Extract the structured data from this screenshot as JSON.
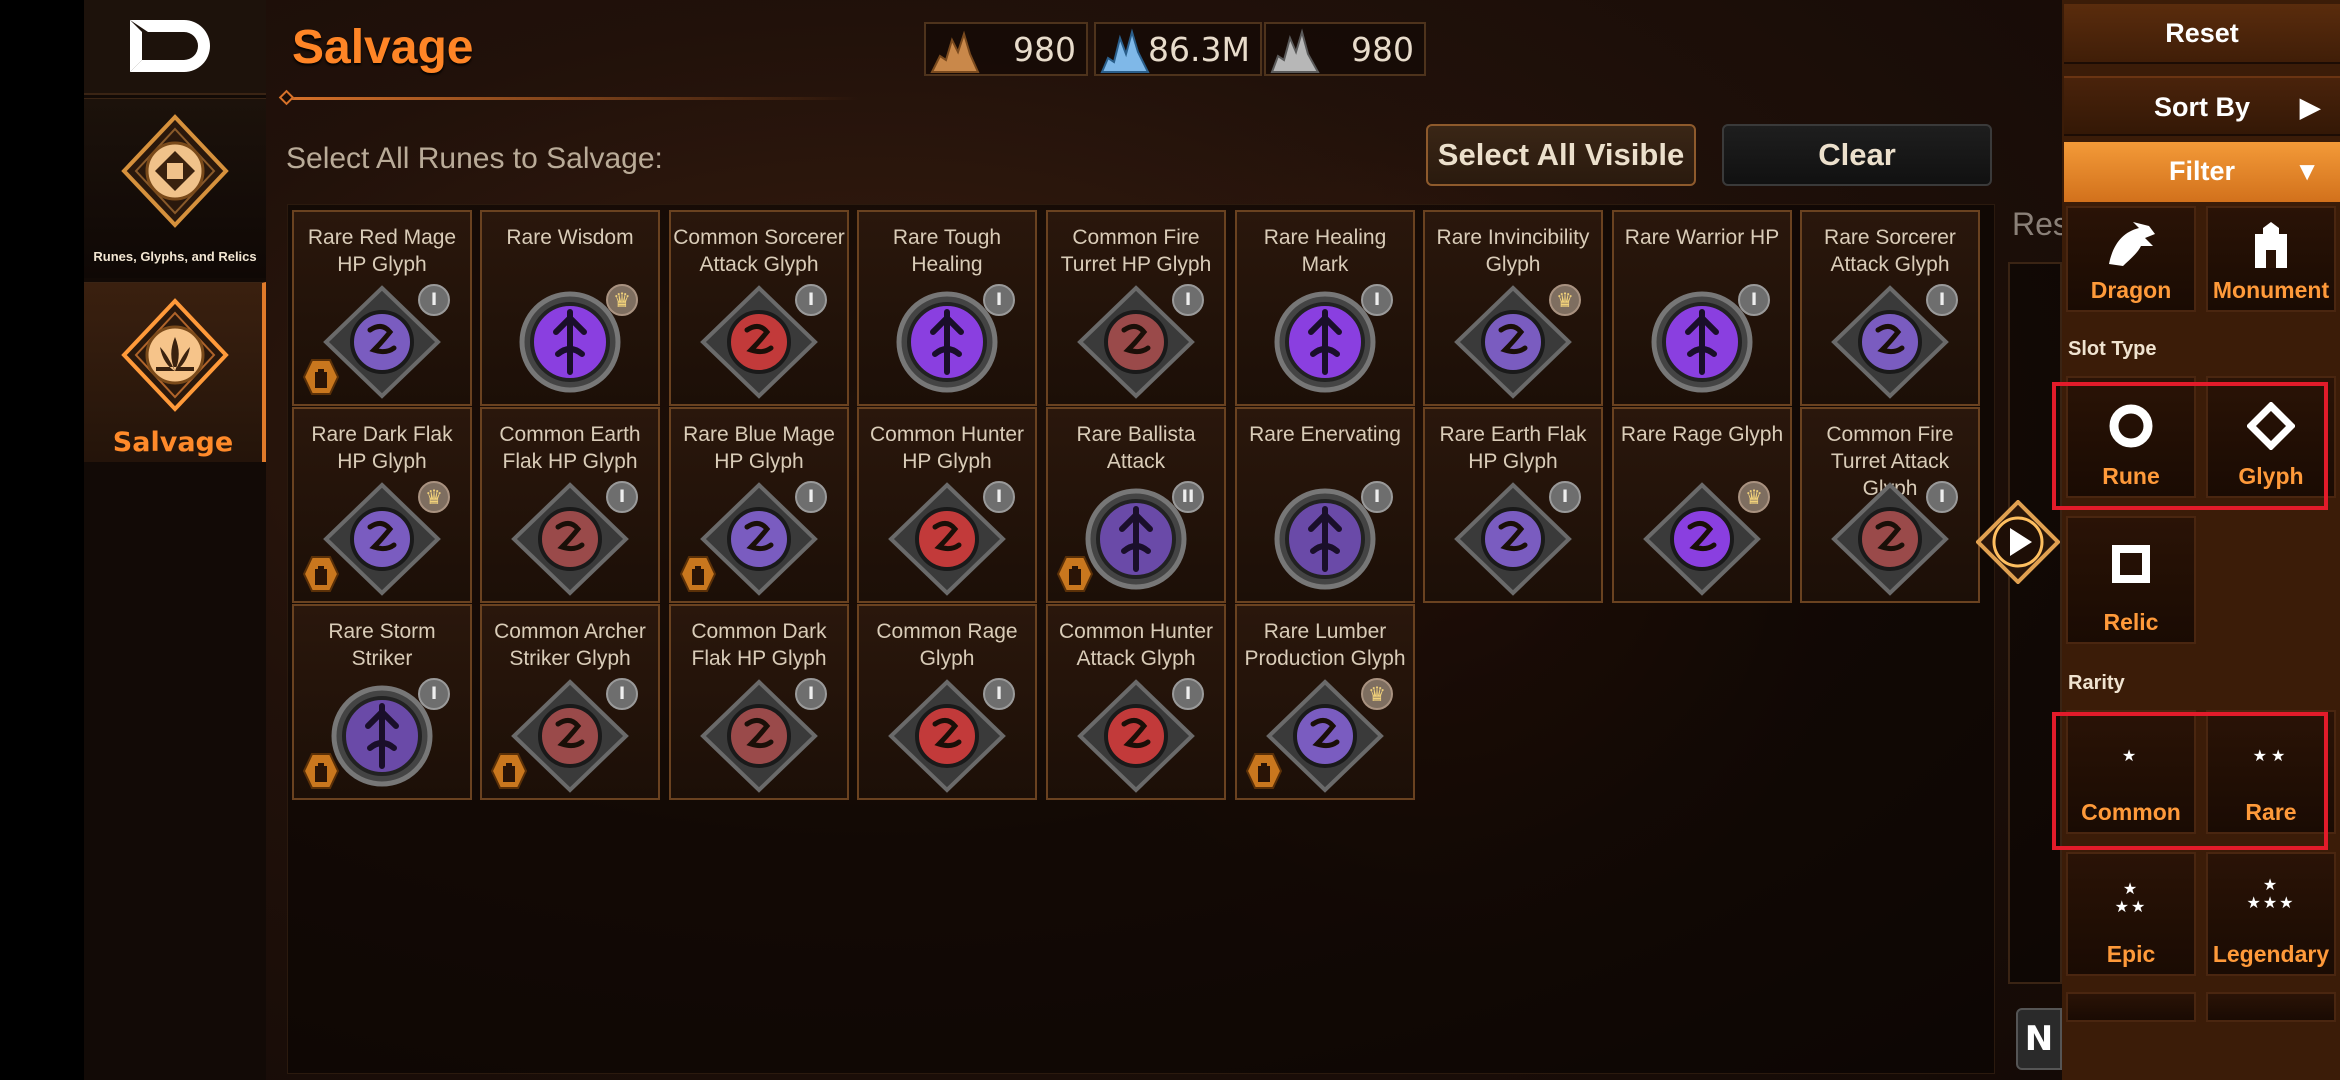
{
  "nav": {
    "back_icon": "back-arrow-icon",
    "tabs": [
      {
        "label": "Runes, Glyphs, and Relics",
        "icon": "rune-diamond-icon"
      },
      {
        "label": "Salvage",
        "icon": "salvage-lotus-icon"
      }
    ]
  },
  "header": {
    "title": "Salvage",
    "currencies": [
      {
        "icon": "dust-pile-icon",
        "value": "980",
        "color": "#c9884a"
      },
      {
        "icon": "crystal-pile-icon",
        "value": "86.3M",
        "color": "#7fb8e8"
      },
      {
        "icon": "silver-pile-icon",
        "value": "980",
        "color": "#b7b7b7"
      }
    ]
  },
  "toolbar": {
    "subtitle": "Select All Runes to Salvage:",
    "select_all_label": "Select All Visible",
    "clear_label": "Clear"
  },
  "items": [
    {
      "name": "Rare Red Mage\nHP Glyph",
      "shape": "glyph",
      "color": "#7a5cc0",
      "badge": "I",
      "crown": false,
      "lock": true
    },
    {
      "name": "Rare Wisdom",
      "shape": "rune",
      "color": "#8a3fe0",
      "badge": "♛",
      "crown": true,
      "lock": false
    },
    {
      "name": "Common Sorcerer\nAttack Glyph",
      "shape": "glyph",
      "color": "#c23a3a",
      "badge": "I",
      "crown": false,
      "lock": false
    },
    {
      "name": "Rare Tough\nHealing",
      "shape": "rune",
      "color": "#8a3fe0",
      "badge": "I",
      "crown": false,
      "lock": false
    },
    {
      "name": "Common Fire\nTurret HP Glyph",
      "shape": "glyph",
      "color": "#9a4a4a",
      "badge": "I",
      "crown": false,
      "lock": false
    },
    {
      "name": "Rare Healing\nMark",
      "shape": "rune",
      "color": "#8a3fe0",
      "badge": "I",
      "crown": false,
      "lock": false
    },
    {
      "name": "Rare Invincibility\nGlyph",
      "shape": "glyph",
      "color": "#7a5cc0",
      "badge": "♛",
      "crown": true,
      "lock": false
    },
    {
      "name": "Rare Warrior HP",
      "shape": "rune",
      "color": "#8a3fe0",
      "badge": "I",
      "crown": false,
      "lock": false
    },
    {
      "name": "Rare Sorcerer\nAttack Glyph",
      "shape": "glyph",
      "color": "#7a5cc0",
      "badge": "I",
      "crown": false,
      "lock": false
    },
    {
      "name": "Rare Dark Flak\nHP Glyph",
      "shape": "glyph",
      "color": "#7a5cc0",
      "badge": "♛",
      "crown": true,
      "lock": true
    },
    {
      "name": "Common Earth\nFlak HP Glyph",
      "shape": "glyph",
      "color": "#9a4a4a",
      "badge": "I",
      "crown": false,
      "lock": false
    },
    {
      "name": "Rare Blue Mage\nHP Glyph",
      "shape": "glyph",
      "color": "#7a5cc0",
      "badge": "I",
      "crown": false,
      "lock": true
    },
    {
      "name": "Common Hunter\nHP Glyph",
      "shape": "glyph",
      "color": "#c23a3a",
      "badge": "I",
      "crown": false,
      "lock": false
    },
    {
      "name": "Rare Ballista\nAttack",
      "shape": "rune",
      "color": "#6a4aa8",
      "badge": "II",
      "crown": false,
      "lock": true
    },
    {
      "name": "Rare Enervating",
      "shape": "rune",
      "color": "#6a4aa8",
      "badge": "I",
      "crown": false,
      "lock": false
    },
    {
      "name": "Rare Earth Flak\nHP Glyph",
      "shape": "glyph",
      "color": "#7a5cc0",
      "badge": "I",
      "crown": false,
      "lock": false
    },
    {
      "name": "Rare Rage Glyph",
      "shape": "glyph",
      "color": "#8a3fe0",
      "badge": "♛",
      "crown": true,
      "lock": false
    },
    {
      "name": "Common Fire\nTurret Attack Glyph",
      "shape": "glyph",
      "color": "#9a4a4a",
      "badge": "I",
      "crown": false,
      "lock": false
    },
    {
      "name": "Rare Storm\nStriker",
      "shape": "rune",
      "color": "#6a4aa8",
      "badge": "I",
      "crown": false,
      "lock": true
    },
    {
      "name": "Common Archer\nStriker Glyph",
      "shape": "glyph",
      "color": "#9a4a4a",
      "badge": "I",
      "crown": false,
      "lock": true
    },
    {
      "name": "Common Dark\nFlak HP Glyph",
      "shape": "glyph",
      "color": "#9a4a4a",
      "badge": "I",
      "crown": false,
      "lock": false
    },
    {
      "name": "Common Rage\nGlyph",
      "shape": "glyph",
      "color": "#c23a3a",
      "badge": "I",
      "crown": false,
      "lock": false
    },
    {
      "name": "Common Hunter\nAttack Glyph",
      "shape": "glyph",
      "color": "#c23a3a",
      "badge": "I",
      "crown": false,
      "lock": false
    },
    {
      "name": "Rare Lumber\nProduction Glyph",
      "shape": "glyph",
      "color": "#7a5cc0",
      "badge": "♛",
      "crown": true,
      "lock": true
    }
  ],
  "side": {
    "res_label": "Res",
    "next_icon": "play-arrow-icon",
    "n_label": "N"
  },
  "filter_panel": {
    "reset_label": "Reset",
    "sort_label": "Sort By",
    "filter_label": "Filter",
    "type_tiles": [
      {
        "label": "Dragon",
        "icon": "dragon-head-icon"
      },
      {
        "label": "Monument",
        "icon": "monument-icon"
      }
    ],
    "slot_type_label": "Slot Type",
    "slot_tiles": [
      {
        "label": "Rune",
        "icon": "circle-icon"
      },
      {
        "label": "Glyph",
        "icon": "diamond-icon"
      },
      {
        "label": "Relic",
        "icon": "square-icon"
      }
    ],
    "rarity_label": "Rarity",
    "rarity_tiles": [
      {
        "label": "Common",
        "stars": "★"
      },
      {
        "label": "Rare",
        "stars": "★★"
      },
      {
        "label": "Epic",
        "stars": "★\n★★"
      },
      {
        "label": "Legendary",
        "stars": "★\n★★★"
      }
    ],
    "highlight_color": "#e21b2a"
  }
}
